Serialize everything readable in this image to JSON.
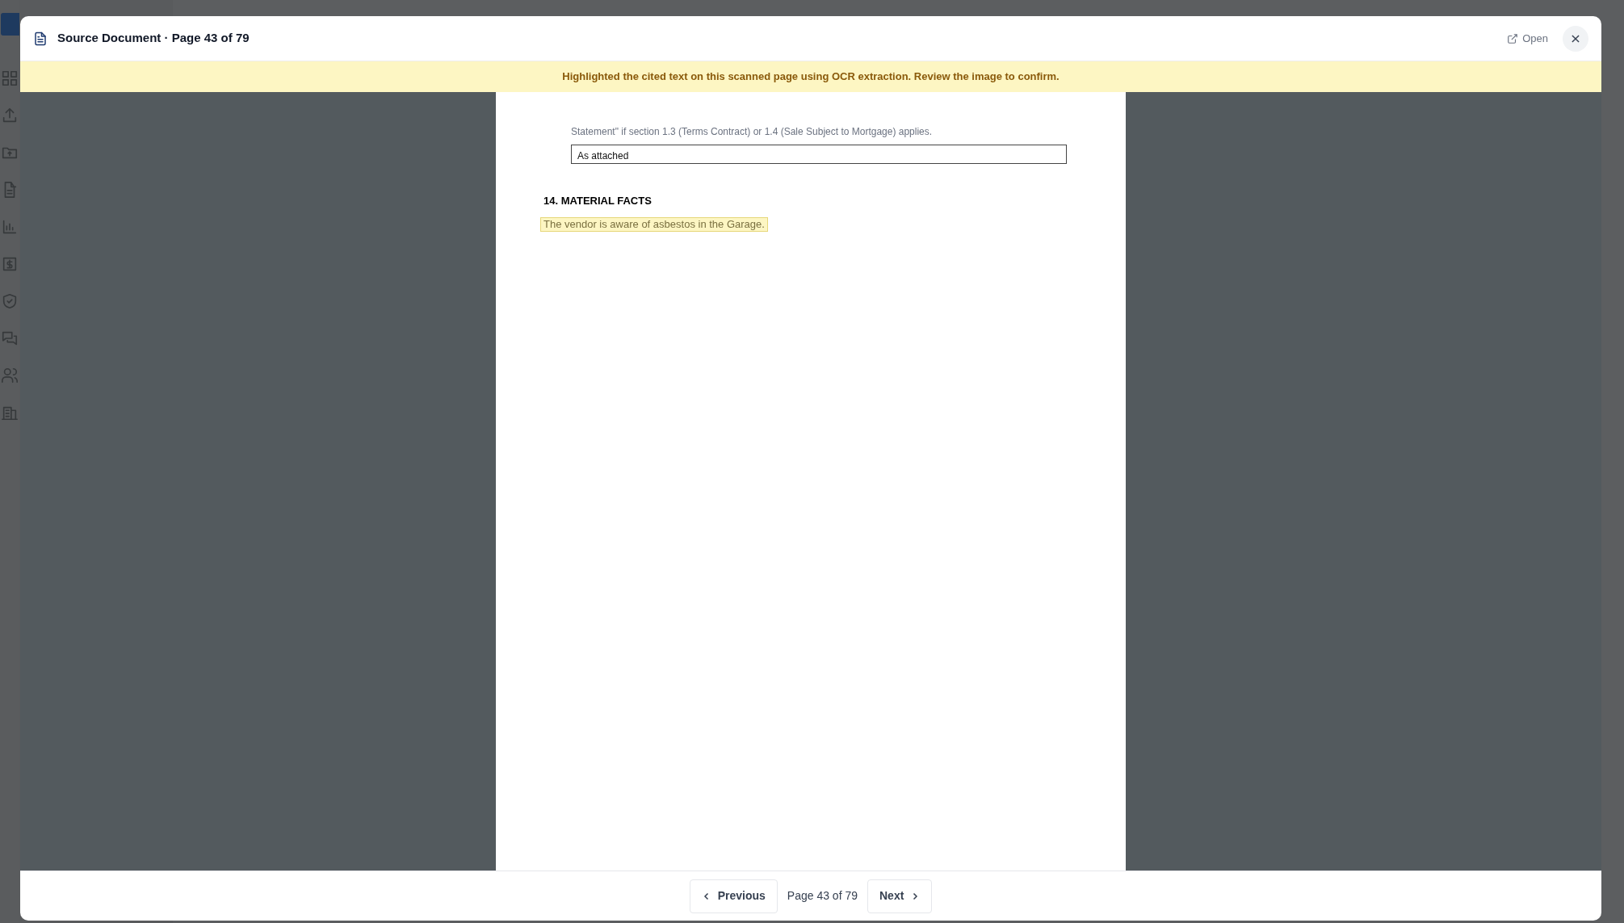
{
  "modal": {
    "title": "Source Document · Page 43 of 79",
    "open_label": "Open",
    "banner": "Highlighted the cited text on this scanned page using OCR extraction. Review the image to confirm.",
    "page": {
      "statement": "Statement\" if section 1.3 (Terms Contract) or 1.4 (Sale Subject to Mortgage) applies.",
      "field_value": "As attached",
      "heading": "14. MATERIAL FACTS",
      "highlighted": "The vendor is aware of asbestos in the Garage."
    },
    "footer": {
      "previous": "Previous",
      "page_label": "Page 43 of 79",
      "next": "Next"
    }
  }
}
